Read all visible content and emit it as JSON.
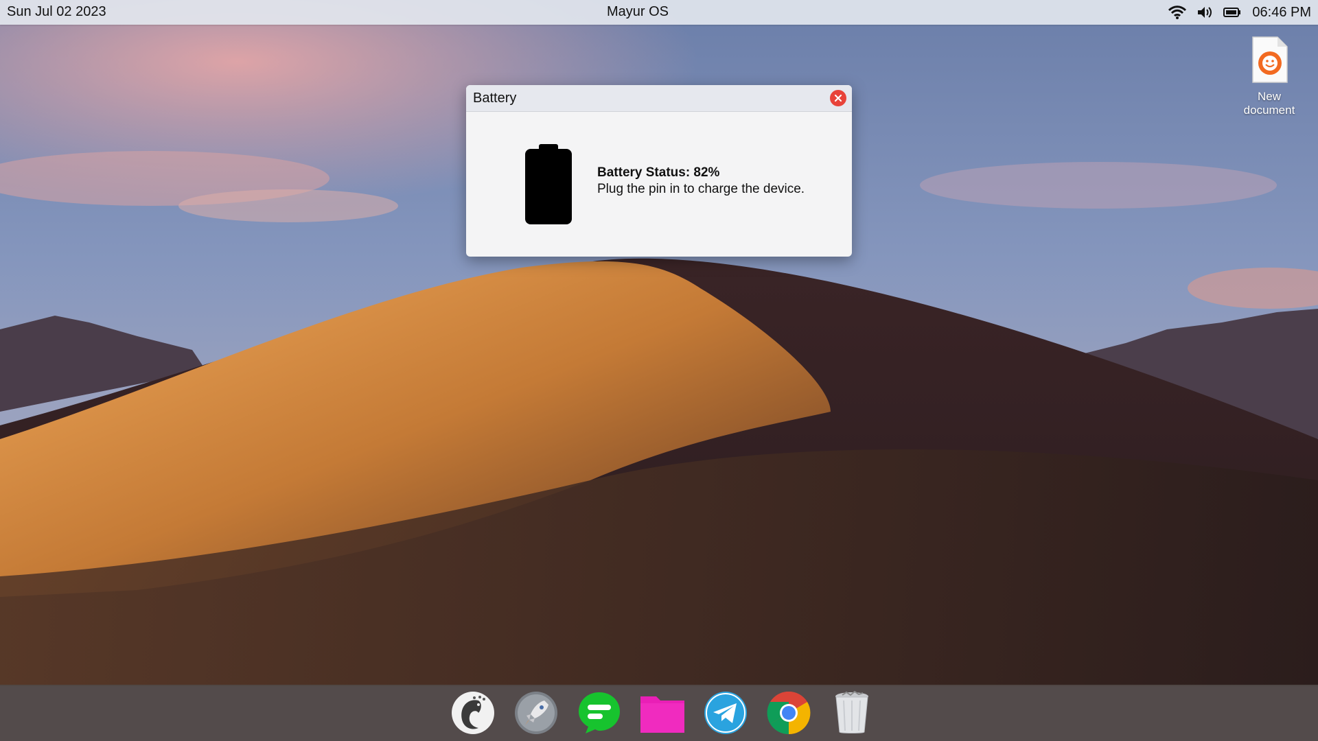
{
  "topbar": {
    "date": "Sun Jul 02 2023",
    "os_name": "Mayur OS",
    "clock": "06:46 PM",
    "tray_icons": [
      "wifi-icon",
      "volume-icon",
      "battery-icon"
    ]
  },
  "desktop_icons": [
    {
      "label": "New document",
      "icon": "document-icon"
    }
  ],
  "battery_window": {
    "title": "Battery",
    "status": "Battery Status: 82%",
    "hint": "Plug the pin in to charge the device.",
    "close_color": "#e8433a"
  },
  "dock": {
    "items": [
      "peacock-app-icon",
      "launchpad-rocket-icon",
      "messages-icon",
      "files-folder-icon",
      "telegram-icon",
      "chrome-icon",
      "trash-icon"
    ]
  },
  "colors": {
    "folder": "#e91fb6",
    "messages": "#17c32e",
    "telegram": "#2aa3df"
  }
}
